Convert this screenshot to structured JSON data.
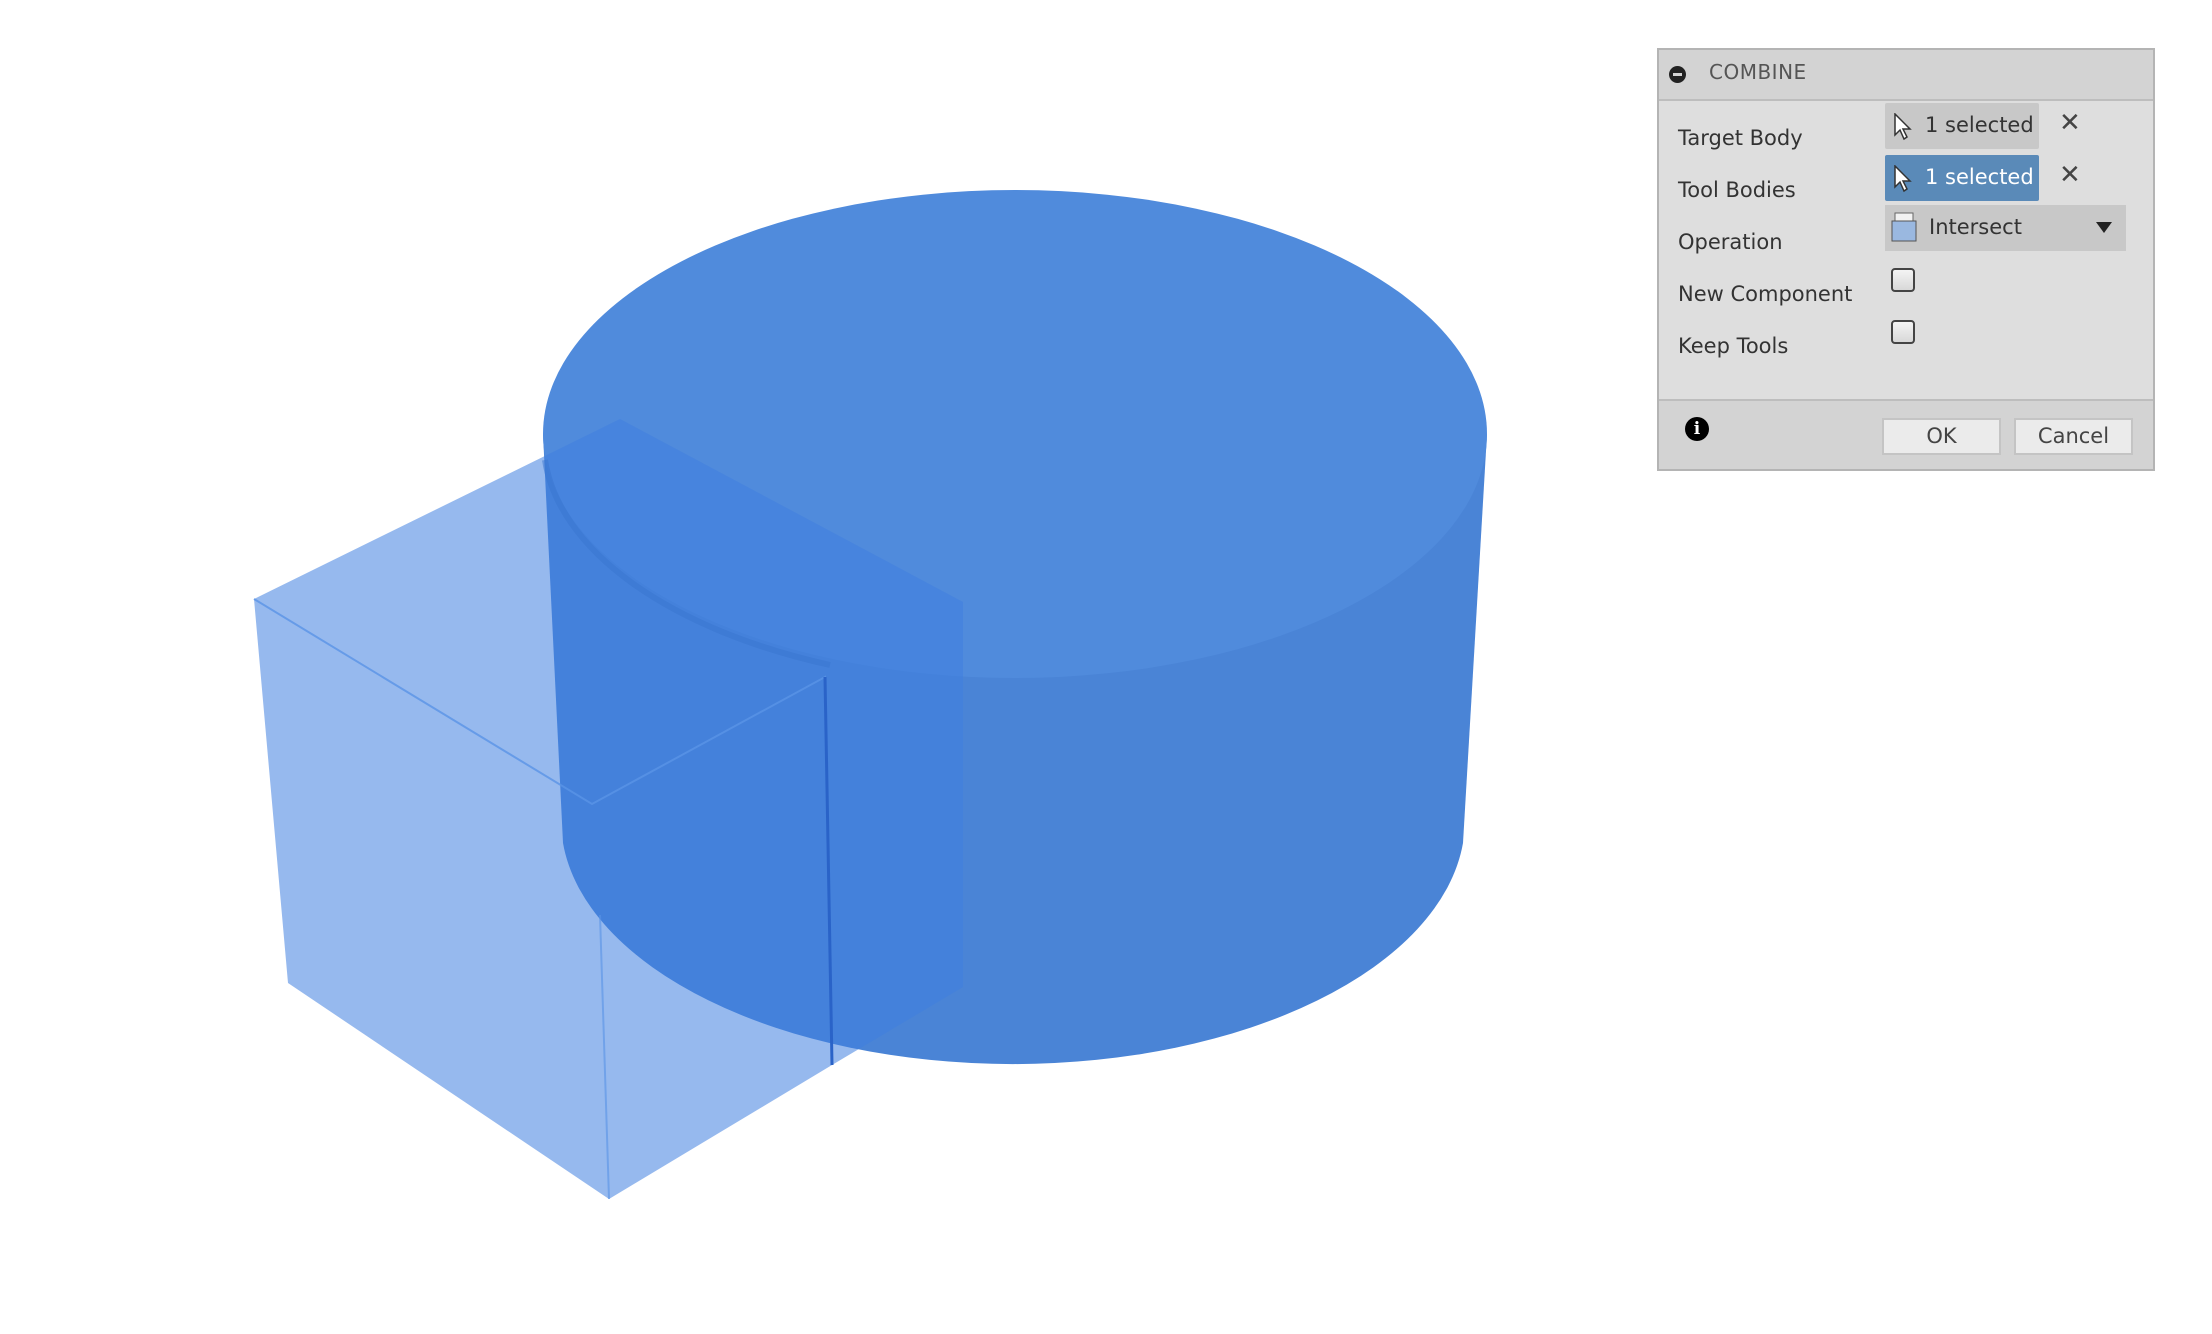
{
  "dialog": {
    "title": "COMBINE",
    "minimize_icon": "minus-circle-icon",
    "fields": {
      "target_body": {
        "label": "Target Body",
        "value": "1 selected",
        "active": false
      },
      "tool_bodies": {
        "label": "Tool Bodies",
        "value": "1 selected",
        "active": true
      },
      "operation": {
        "label": "Operation",
        "value": "Intersect"
      },
      "new_component": {
        "label": "New Component",
        "checked": false
      },
      "keep_tools": {
        "label": "Keep Tools",
        "checked": false
      }
    },
    "info_icon": "i",
    "ok_label": "OK",
    "cancel_label": "Cancel",
    "clear_icon": "✕"
  },
  "colors": {
    "body": "#4a86da",
    "selection_active": "#5a8ab8"
  }
}
